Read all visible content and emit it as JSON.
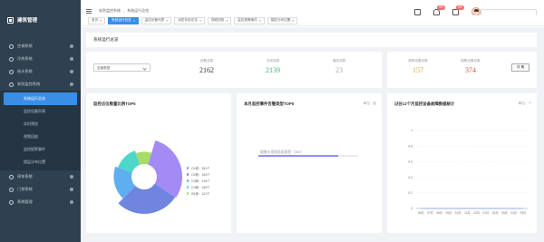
{
  "sidebar": {
    "title": "建筑管理",
    "items": [
      {
        "label": "空调系统",
        "icon": "snowflake-icon"
      },
      {
        "label": "冷热系统",
        "icon": "fan-icon"
      },
      {
        "label": "给水系统",
        "icon": "water-icon"
      },
      {
        "label": "安防监控系统",
        "icon": "camera-icon"
      },
      {
        "label": "停车系统",
        "icon": "car-icon"
      },
      {
        "label": "门禁系统",
        "icon": "door-icon"
      },
      {
        "label": "系统管理",
        "icon": "gear-icon"
      }
    ],
    "submenu": [
      {
        "label": "系统运行总览",
        "active": true
      },
      {
        "label": "监控设备列表",
        "active": false
      },
      {
        "label": "实时预览",
        "active": false
      },
      {
        "label": "视频回放",
        "active": false
      },
      {
        "label": "监控报警事件",
        "active": false
      },
      {
        "label": "楼层分布位置",
        "active": false
      }
    ]
  },
  "topbar": {
    "breadcrumb": [
      "安防监控系统",
      "系统运行总览"
    ],
    "badges": [
      "99+",
      "99+"
    ],
    "icons": [
      "message-icon",
      "bell-icon",
      "mail-icon",
      "user-avatar"
    ]
  },
  "tabs": [
    {
      "label": "首页",
      "active": false
    },
    {
      "label": "系统运行总览",
      "active": true
    },
    {
      "label": "监控设备列表",
      "active": false
    },
    {
      "label": "设防状态总览",
      "active": false
    },
    {
      "label": "视频回放",
      "active": false
    },
    {
      "label": "监控报警事件",
      "active": false
    },
    {
      "label": "楼层分布位置",
      "active": false
    }
  ],
  "page": {
    "title": "系统运行总览",
    "filter_select": "全部类型",
    "stats_left": [
      {
        "label": "设备总数",
        "value": "2162",
        "color": "#333333"
      },
      {
        "label": "在线总数",
        "value": "2139",
        "color": "#3cb371"
      },
      {
        "label": "离线总数",
        "value": "23",
        "color": "#aaaaaa"
      }
    ],
    "stats_right": [
      {
        "label": "故障设备总数",
        "value": "157",
        "color": "#e6a23c"
      },
      {
        "label": "报警设备总数",
        "value": "374",
        "color": "#e0504a"
      }
    ],
    "detail_button": "详 情"
  },
  "panels": {
    "distribution": {
      "title": "监控点位数量比例TOP5",
      "legend": [
        {
          "label": "D1栋：351个",
          "color": "#a48af5"
        },
        {
          "label": "D2栋：334个",
          "color": "#6f85e0"
        },
        {
          "label": "D3栋：216个",
          "color": "#5eaef0"
        },
        {
          "label": "D4栋：169个",
          "color": "#4dd7c8"
        },
        {
          "label": "B1栋：121个",
          "color": "#a7dc67"
        }
      ]
    },
    "alarm_types": {
      "title": "本月监控事件告警类型TOP5",
      "unit": "单位：起",
      "item": "摄像头视频画面报警（369）",
      "fill_fraction": 0.8
    },
    "trend": {
      "title": "过往12个月监控设备故障数据统计",
      "unit": "单位：个"
    }
  },
  "chart_data": [
    {
      "type": "pie",
      "title": "监控点位数量比例TOP5",
      "categories": [
        "D1栋",
        "D2栋",
        "D3栋",
        "D4栋",
        "B1栋"
      ],
      "values": [
        351,
        334,
        216,
        169,
        121
      ]
    },
    {
      "type": "bar",
      "title": "本月监控事件告警类型TOP5",
      "categories": [
        "摄像头视频画面报警"
      ],
      "values": [
        369
      ]
    },
    {
      "type": "line",
      "title": "过往12个月监控设备故障数据统计",
      "x": [
        "06月",
        "07月",
        "08月",
        "09月",
        "10月",
        "11月",
        "12月",
        "01月",
        "02月",
        "03月",
        "04月",
        "05月"
      ],
      "values": [
        0,
        0,
        0,
        0,
        0,
        0,
        0,
        0,
        0,
        0,
        0,
        0
      ],
      "ylim": [
        0,
        1
      ],
      "yticks": [
        "0",
        "0.2",
        "0.4",
        "0.6",
        "0.8",
        "1"
      ]
    }
  ]
}
